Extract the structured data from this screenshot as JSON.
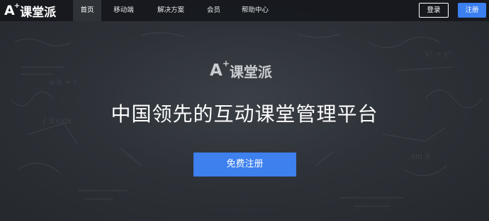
{
  "header": {
    "logo_prefix": "A",
    "logo_plus": "+",
    "logo_text": "课堂派",
    "nav": [
      {
        "label": "首页"
      },
      {
        "label": "移动端"
      },
      {
        "label": "解决方案"
      },
      {
        "label": "会员"
      },
      {
        "label": "帮助中心"
      }
    ],
    "login_label": "登录",
    "register_label": "注册"
  },
  "hero": {
    "logo_prefix": "A",
    "logo_plus": "+",
    "logo_text": "课堂派",
    "headline": "中国领先的互动课堂管理平台",
    "cta_label": "免费注册"
  },
  "colors": {
    "accent": "#3d80ee",
    "topbar": "#16181c",
    "background": "#2e3238"
  }
}
